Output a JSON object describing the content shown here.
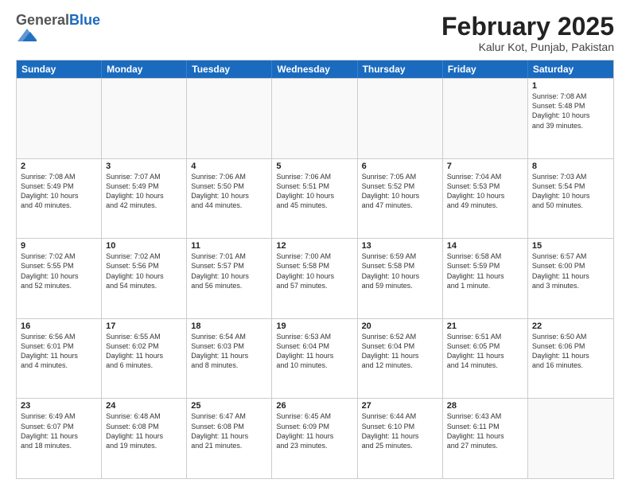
{
  "logo": {
    "general": "General",
    "blue": "Blue"
  },
  "title": "February 2025",
  "subtitle": "Kalur Kot, Punjab, Pakistan",
  "headers": [
    "Sunday",
    "Monday",
    "Tuesday",
    "Wednesday",
    "Thursday",
    "Friday",
    "Saturday"
  ],
  "weeks": [
    [
      {
        "day": "",
        "info": ""
      },
      {
        "day": "",
        "info": ""
      },
      {
        "day": "",
        "info": ""
      },
      {
        "day": "",
        "info": ""
      },
      {
        "day": "",
        "info": ""
      },
      {
        "day": "",
        "info": ""
      },
      {
        "day": "1",
        "info": "Sunrise: 7:08 AM\nSunset: 5:48 PM\nDaylight: 10 hours\nand 39 minutes."
      }
    ],
    [
      {
        "day": "2",
        "info": "Sunrise: 7:08 AM\nSunset: 5:49 PM\nDaylight: 10 hours\nand 40 minutes."
      },
      {
        "day": "3",
        "info": "Sunrise: 7:07 AM\nSunset: 5:49 PM\nDaylight: 10 hours\nand 42 minutes."
      },
      {
        "day": "4",
        "info": "Sunrise: 7:06 AM\nSunset: 5:50 PM\nDaylight: 10 hours\nand 44 minutes."
      },
      {
        "day": "5",
        "info": "Sunrise: 7:06 AM\nSunset: 5:51 PM\nDaylight: 10 hours\nand 45 minutes."
      },
      {
        "day": "6",
        "info": "Sunrise: 7:05 AM\nSunset: 5:52 PM\nDaylight: 10 hours\nand 47 minutes."
      },
      {
        "day": "7",
        "info": "Sunrise: 7:04 AM\nSunset: 5:53 PM\nDaylight: 10 hours\nand 49 minutes."
      },
      {
        "day": "8",
        "info": "Sunrise: 7:03 AM\nSunset: 5:54 PM\nDaylight: 10 hours\nand 50 minutes."
      }
    ],
    [
      {
        "day": "9",
        "info": "Sunrise: 7:02 AM\nSunset: 5:55 PM\nDaylight: 10 hours\nand 52 minutes."
      },
      {
        "day": "10",
        "info": "Sunrise: 7:02 AM\nSunset: 5:56 PM\nDaylight: 10 hours\nand 54 minutes."
      },
      {
        "day": "11",
        "info": "Sunrise: 7:01 AM\nSunset: 5:57 PM\nDaylight: 10 hours\nand 56 minutes."
      },
      {
        "day": "12",
        "info": "Sunrise: 7:00 AM\nSunset: 5:58 PM\nDaylight: 10 hours\nand 57 minutes."
      },
      {
        "day": "13",
        "info": "Sunrise: 6:59 AM\nSunset: 5:58 PM\nDaylight: 10 hours\nand 59 minutes."
      },
      {
        "day": "14",
        "info": "Sunrise: 6:58 AM\nSunset: 5:59 PM\nDaylight: 11 hours\nand 1 minute."
      },
      {
        "day": "15",
        "info": "Sunrise: 6:57 AM\nSunset: 6:00 PM\nDaylight: 11 hours\nand 3 minutes."
      }
    ],
    [
      {
        "day": "16",
        "info": "Sunrise: 6:56 AM\nSunset: 6:01 PM\nDaylight: 11 hours\nand 4 minutes."
      },
      {
        "day": "17",
        "info": "Sunrise: 6:55 AM\nSunset: 6:02 PM\nDaylight: 11 hours\nand 6 minutes."
      },
      {
        "day": "18",
        "info": "Sunrise: 6:54 AM\nSunset: 6:03 PM\nDaylight: 11 hours\nand 8 minutes."
      },
      {
        "day": "19",
        "info": "Sunrise: 6:53 AM\nSunset: 6:04 PM\nDaylight: 11 hours\nand 10 minutes."
      },
      {
        "day": "20",
        "info": "Sunrise: 6:52 AM\nSunset: 6:04 PM\nDaylight: 11 hours\nand 12 minutes."
      },
      {
        "day": "21",
        "info": "Sunrise: 6:51 AM\nSunset: 6:05 PM\nDaylight: 11 hours\nand 14 minutes."
      },
      {
        "day": "22",
        "info": "Sunrise: 6:50 AM\nSunset: 6:06 PM\nDaylight: 11 hours\nand 16 minutes."
      }
    ],
    [
      {
        "day": "23",
        "info": "Sunrise: 6:49 AM\nSunset: 6:07 PM\nDaylight: 11 hours\nand 18 minutes."
      },
      {
        "day": "24",
        "info": "Sunrise: 6:48 AM\nSunset: 6:08 PM\nDaylight: 11 hours\nand 19 minutes."
      },
      {
        "day": "25",
        "info": "Sunrise: 6:47 AM\nSunset: 6:08 PM\nDaylight: 11 hours\nand 21 minutes."
      },
      {
        "day": "26",
        "info": "Sunrise: 6:45 AM\nSunset: 6:09 PM\nDaylight: 11 hours\nand 23 minutes."
      },
      {
        "day": "27",
        "info": "Sunrise: 6:44 AM\nSunset: 6:10 PM\nDaylight: 11 hours\nand 25 minutes."
      },
      {
        "day": "28",
        "info": "Sunrise: 6:43 AM\nSunset: 6:11 PM\nDaylight: 11 hours\nand 27 minutes."
      },
      {
        "day": "",
        "info": ""
      }
    ]
  ]
}
